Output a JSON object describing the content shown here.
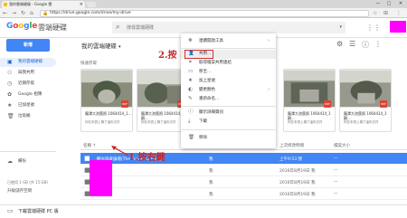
{
  "browser": {
    "tab_title": "我的雲端硬碟 - Google 雲",
    "tab_close": "×",
    "url": "https://drive.google.com/drive/my-drive",
    "secure_label": "🔒",
    "win_min": "—",
    "win_max": "□",
    "win_close": "✕"
  },
  "header": {
    "logo": "Google",
    "product": "雲端硬碟",
    "search_placeholder": "搜尋雲端硬碟"
  },
  "toolbar": {
    "new_label": "新增",
    "drive_title": "我的雲端硬碟",
    "caret": "▾"
  },
  "sidebar": {
    "items": [
      {
        "label": "我的雲端硬碟",
        "icon": "drive-icon",
        "glyph": "▣"
      },
      {
        "label": "與我共用",
        "icon": "shared-icon",
        "glyph": "⚇"
      },
      {
        "label": "近期存取",
        "icon": "recent-icon",
        "glyph": "◷"
      },
      {
        "label": "Google 相簿",
        "icon": "photos-icon",
        "glyph": "✿"
      },
      {
        "label": "已加星號",
        "icon": "star-icon",
        "glyph": "★"
      },
      {
        "label": "垃圾桶",
        "icon": "trash-icon",
        "glyph": "🗑"
      },
      {
        "label": "備份",
        "icon": "backup-icon",
        "glyph": "☁"
      }
    ],
    "storage": "已使用 1 GB (共 15 GB)",
    "upgrade": "升級儲存空間"
  },
  "bottom": {
    "label": "下載雲端硬碟 PC 版"
  },
  "quick_access": {
    "title": "快速存取",
    "cards": [
      {
        "title": "龍潭大池舊照 1064414_1...",
        "sub": "你在本週上傳了這份文件"
      },
      {
        "title": "龍潭大池舊照 1064414_1 觀...",
        "sub": "你在本週上傳了這份文件"
      },
      {
        "title": "龍潭大池舊照 1064414_1 觀...",
        "sub": "你在本週上傳了這份文件"
      },
      {
        "title": "龍潭大池舊照 1064414_1 觀...",
        "sub": "你在本週上傳了這份文件"
      }
    ]
  },
  "list": {
    "headers": {
      "name": "名稱 ↑",
      "owner": "擁有者",
      "modified": "上次修改時間",
      "size": "檔案大小"
    },
    "rows": [
      {
        "name": "觀光協會論壇(The Forum of Fong)",
        "owner": "我",
        "modified": "上午9:53 我",
        "size": "—",
        "selected": true
      },
      {
        "name": "",
        "owner": "我",
        "modified": "2016年8月19日 我",
        "size": "—",
        "selected": false
      },
      {
        "name": "",
        "owner": "我",
        "modified": "2016年8月19日 我",
        "size": "—",
        "selected": false
      },
      {
        "name": "",
        "owner": "我",
        "modified": "2016年8月19日 我",
        "size": "—",
        "selected": false
      }
    ]
  },
  "context_menu": {
    "items": [
      {
        "label": "連續開啟工具",
        "icon": "move-icon",
        "glyph": "✥",
        "sub": "›"
      },
      {
        "label": "共用...",
        "icon": "share-icon",
        "glyph": "👤",
        "sub": ""
      },
      {
        "label": "取得檔案共用連結",
        "icon": "link-icon",
        "glyph": "⚭",
        "sub": ""
      },
      {
        "label": "移至...",
        "icon": "folder-move-icon",
        "glyph": "▭",
        "sub": ""
      },
      {
        "label": "加上星號",
        "icon": "star-icon",
        "glyph": "★",
        "sub": ""
      },
      {
        "label": "變更顏色",
        "icon": "palette-icon",
        "glyph": "◐",
        "sub": "›"
      },
      {
        "label": "重新命名...",
        "icon": "rename-icon",
        "glyph": "✎",
        "sub": ""
      },
      {
        "label": "顯示詳細資訊",
        "icon": "info-icon",
        "glyph": "ⓘ",
        "sub": ""
      },
      {
        "label": "下載",
        "icon": "download-icon",
        "glyph": "⤓",
        "sub": ""
      },
      {
        "label": "移除",
        "icon": "delete-icon",
        "glyph": "🗑",
        "sub": ""
      }
    ]
  },
  "annotations": {
    "step1": "1.按右鍵",
    "step2": "2.按"
  },
  "colors": {
    "accent": "#4285f4",
    "redact": "#ff00ff",
    "annotation": "#c62828"
  }
}
